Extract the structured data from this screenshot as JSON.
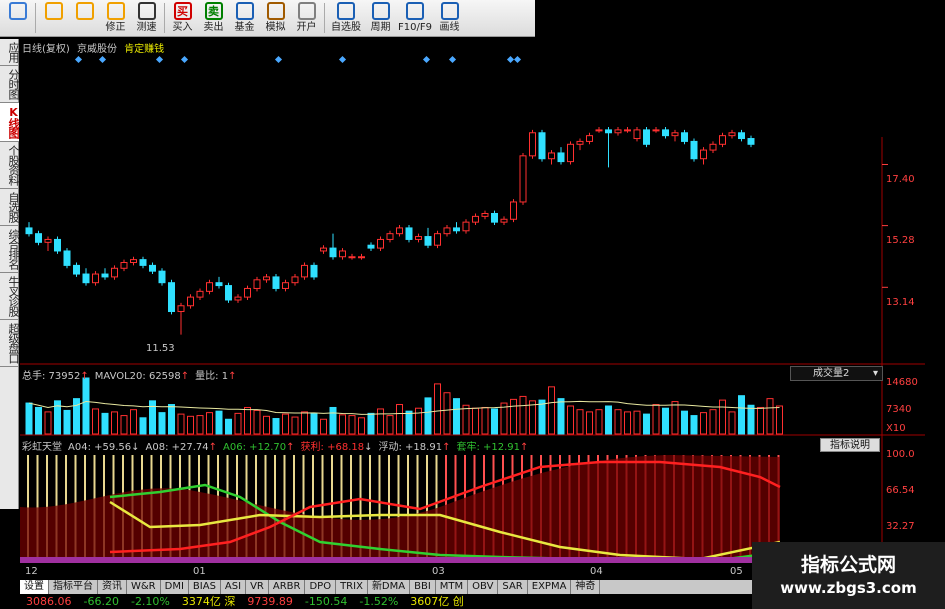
{
  "toolbar": [
    {
      "label": "",
      "icon": "app-icon",
      "color": "#3a7bd5"
    },
    {
      "label": "",
      "icon": "back-icon",
      "color": "#f0a000"
    },
    {
      "label": "",
      "icon": "up-down-icon",
      "color": "#f0a000"
    },
    {
      "label": "修正",
      "icon": "fix-icon",
      "color": "#f0a000"
    },
    {
      "label": "测速",
      "icon": "clock-icon",
      "color": "#333333"
    },
    {
      "label": "买入",
      "icon": "buy-icon",
      "glyph": "买",
      "color": "#d00000"
    },
    {
      "label": "卖出",
      "icon": "sell-icon",
      "glyph": "卖",
      "color": "#008000"
    },
    {
      "label": "基金",
      "icon": "fund-icon",
      "color": "#1a5fb4"
    },
    {
      "label": "模拟",
      "icon": "hammer-icon",
      "color": "#a05a00"
    },
    {
      "label": "开户",
      "icon": "lock-icon",
      "color": "#808080"
    },
    {
      "label": "自选股",
      "icon": "star-icon",
      "color": "#1a5fb4"
    },
    {
      "label": "周期",
      "icon": "period-icon",
      "color": "#1a5fb4"
    },
    {
      "label": "F10/F9",
      "icon": "f10-icon",
      "color": "#1a5fb4"
    },
    {
      "label": "画线",
      "icon": "pen-icon",
      "color": "#1a5fb4"
    }
  ],
  "left_tabs": [
    {
      "label": "应用",
      "active": false
    },
    {
      "label": "分时图",
      "active": false
    },
    {
      "label": "K线图",
      "active": true
    },
    {
      "label": "个股资料",
      "active": false
    },
    {
      "label": "自选股",
      "active": false
    },
    {
      "label": "综合排名",
      "active": false
    },
    {
      "label": "牛叉诊股",
      "active": false
    },
    {
      "label": "超级盘口",
      "active": false
    }
  ],
  "header": {
    "period": "日线(复权)",
    "stock": "京威股份",
    "formula": "肯定赚钱"
  },
  "volume": {
    "legend": [
      {
        "text": "总手: 73952",
        "arrow": "↑"
      },
      {
        "text": "MAVOL20: 62598",
        "arrow": "↑"
      },
      {
        "text": "量比: 1",
        "arrow": "↑"
      }
    ],
    "selector": "成交量2",
    "axis": [
      "14680",
      "7340",
      "X10"
    ]
  },
  "indicator": {
    "name": "彩虹天堂",
    "legend": [
      {
        "text": "A04: +59.56",
        "arrow": "↓",
        "color": "#c8c8c8"
      },
      {
        "text": "A08: +27.74",
        "arrow": "↑",
        "color": "#c8c8c8"
      },
      {
        "text": "A06: +12.70",
        "arrow": "↑",
        "color": "#30c030"
      },
      {
        "text": "获利: +68.18",
        "arrow": "↓",
        "color": "#ff3030"
      },
      {
        "text": "浮动: +18.91",
        "arrow": "↑",
        "color": "#c8c8c8"
      },
      {
        "text": "套牢: +12.91",
        "arrow": "↑",
        "color": "#30c030"
      }
    ],
    "help": "指标说明",
    "axis": [
      "100.0",
      "66.54",
      "32.27"
    ]
  },
  "price_axis": [
    "17.40",
    "15.28",
    "13.14"
  ],
  "low_label": "11.53",
  "date_labels": [
    "12",
    "01",
    "03",
    "04",
    "05"
  ],
  "bottom_tabs": [
    "设置",
    "指标平台",
    "资讯",
    "W&R",
    "DMI",
    "BIAS",
    "ASI",
    "VR",
    "ARBR",
    "DPO",
    "TRIX",
    "新DMA",
    "BBI",
    "MTM",
    "OBV",
    "SAR",
    "EXPMA",
    "神奇"
  ],
  "status": [
    {
      "text": "3086.06",
      "color": "#ff4040"
    },
    {
      "text": "-66.20",
      "color": "#30c030"
    },
    {
      "text": "-2.10%",
      "color": "#30c030"
    },
    {
      "text": "3374亿 深",
      "color": "#e8e800"
    },
    {
      "text": "9739.89",
      "color": "#ff4040"
    },
    {
      "text": "-150.54",
      "color": "#30c030"
    },
    {
      "text": "-1.52%",
      "color": "#30c030"
    },
    {
      "text": "3607亿 创",
      "color": "#e8e800"
    }
  ],
  "watermark": {
    "title": "指标公式网",
    "url": "www.zbgs3.com"
  },
  "chart_data": {
    "type": "candlestick",
    "price_ticks": [
      17.4,
      15.28,
      13.14
    ],
    "volume_ticks": [
      14680,
      7340
    ],
    "indicator_ticks": [
      100.0,
      66.54,
      32.27
    ],
    "low_marker": 11.53,
    "ylim": [
      11.0,
      18.7
    ],
    "candles": [
      [
        15.2,
        15.4,
        14.9,
        15.0
      ],
      [
        15.0,
        15.1,
        14.6,
        14.7
      ],
      [
        14.7,
        14.9,
        14.4,
        14.8
      ],
      [
        14.8,
        14.9,
        14.3,
        14.4
      ],
      [
        14.4,
        14.5,
        13.8,
        13.9
      ],
      [
        13.9,
        14.0,
        13.5,
        13.6
      ],
      [
        13.6,
        13.8,
        13.2,
        13.3
      ],
      [
        13.3,
        13.7,
        13.2,
        13.6
      ],
      [
        13.6,
        13.8,
        13.4,
        13.5
      ],
      [
        13.5,
        13.9,
        13.4,
        13.8
      ],
      [
        13.8,
        14.1,
        13.7,
        14.0
      ],
      [
        14.0,
        14.2,
        13.9,
        14.1
      ],
      [
        14.1,
        14.2,
        13.8,
        13.9
      ],
      [
        13.9,
        14.0,
        13.6,
        13.7
      ],
      [
        13.7,
        13.8,
        13.2,
        13.3
      ],
      [
        13.3,
        13.4,
        12.2,
        12.3
      ],
      [
        12.3,
        12.6,
        11.5,
        12.5
      ],
      [
        12.5,
        12.9,
        12.4,
        12.8
      ],
      [
        12.8,
        13.1,
        12.7,
        13.0
      ],
      [
        13.0,
        13.4,
        12.9,
        13.3
      ],
      [
        13.3,
        13.5,
        13.1,
        13.2
      ],
      [
        13.2,
        13.3,
        12.6,
        12.7
      ],
      [
        12.7,
        12.9,
        12.6,
        12.8
      ],
      [
        12.8,
        13.2,
        12.7,
        13.1
      ],
      [
        13.1,
        13.5,
        13.0,
        13.4
      ],
      [
        13.4,
        13.6,
        13.3,
        13.5
      ],
      [
        13.5,
        13.6,
        13.0,
        13.1
      ],
      [
        13.1,
        13.4,
        13.0,
        13.3
      ],
      [
        13.3,
        13.6,
        13.2,
        13.5
      ],
      [
        13.5,
        14.0,
        13.4,
        13.9
      ],
      [
        13.9,
        14.0,
        13.4,
        13.5
      ],
      [
        14.4,
        14.6,
        14.3,
        14.5
      ],
      [
        14.5,
        15.0,
        14.1,
        14.2
      ],
      [
        14.2,
        14.5,
        14.1,
        14.4
      ],
      [
        14.2,
        14.3,
        14.1,
        14.2
      ],
      [
        14.2,
        14.3,
        14.1,
        14.2
      ],
      [
        14.6,
        14.7,
        14.4,
        14.5
      ],
      [
        14.5,
        14.9,
        14.4,
        14.8
      ],
      [
        14.8,
        15.1,
        14.7,
        15.0
      ],
      [
        15.0,
        15.3,
        14.9,
        15.2
      ],
      [
        15.2,
        15.3,
        14.7,
        14.8
      ],
      [
        14.8,
        15.0,
        14.7,
        14.9
      ],
      [
        14.9,
        15.2,
        14.5,
        14.6
      ],
      [
        14.6,
        15.1,
        14.5,
        15.0
      ],
      [
        15.0,
        15.3,
        14.9,
        15.2
      ],
      [
        15.2,
        15.4,
        15.0,
        15.1
      ],
      [
        15.1,
        15.5,
        15.0,
        15.4
      ],
      [
        15.4,
        15.7,
        15.3,
        15.6
      ],
      [
        15.6,
        15.8,
        15.5,
        15.7
      ],
      [
        15.7,
        15.8,
        15.3,
        15.4
      ],
      [
        15.4,
        15.6,
        15.3,
        15.5
      ],
      [
        15.5,
        16.2,
        15.4,
        16.1
      ],
      [
        16.1,
        17.8,
        16.0,
        17.7
      ],
      [
        17.7,
        18.6,
        17.6,
        18.5
      ],
      [
        18.5,
        18.6,
        17.5,
        17.6
      ],
      [
        17.6,
        17.9,
        17.4,
        17.8
      ],
      [
        17.8,
        18.0,
        17.4,
        17.5
      ],
      [
        17.5,
        18.2,
        17.4,
        18.1
      ],
      [
        18.1,
        18.3,
        17.9,
        18.2
      ],
      [
        18.2,
        18.5,
        18.1,
        18.4
      ],
      [
        18.6,
        18.7,
        18.5,
        18.6
      ],
      [
        18.6,
        18.7,
        17.3,
        18.5
      ],
      [
        18.5,
        18.7,
        18.4,
        18.6
      ],
      [
        18.6,
        18.7,
        18.5,
        18.6
      ],
      [
        18.3,
        18.7,
        18.2,
        18.6
      ],
      [
        18.6,
        18.7,
        18.0,
        18.1
      ],
      [
        18.6,
        18.7,
        18.5,
        18.6
      ],
      [
        18.6,
        18.7,
        18.3,
        18.4
      ],
      [
        18.4,
        18.6,
        18.2,
        18.5
      ],
      [
        18.5,
        18.6,
        18.1,
        18.2
      ],
      [
        18.2,
        18.3,
        17.5,
        17.6
      ],
      [
        17.6,
        18.0,
        17.4,
        17.9
      ],
      [
        17.9,
        18.2,
        17.8,
        18.1
      ],
      [
        18.1,
        18.5,
        18.0,
        18.4
      ],
      [
        18.4,
        18.6,
        18.3,
        18.5
      ],
      [
        18.5,
        18.6,
        18.2,
        18.3
      ],
      [
        18.3,
        18.4,
        18.0,
        18.1
      ]
    ],
    "volumes": [
      4.2,
      3.6,
      3.0,
      4.5,
      3.2,
      4.8,
      7.6,
      3.4,
      2.8,
      3.0,
      2.5,
      3.3,
      2.2,
      4.5,
      2.9,
      4.0,
      2.7,
      2.4,
      2.5,
      2.9,
      3.1,
      2.0,
      2.8,
      3.6,
      3.2,
      2.4,
      2.1,
      2.7,
      2.3,
      3.0,
      2.8,
      2.0,
      3.6,
      2.6,
      2.5,
      2.2,
      2.8,
      3.4,
      2.5,
      4.0,
      3.1,
      3.5,
      4.9,
      6.8,
      5.6,
      4.8,
      3.9,
      3.5,
      3.6,
      3.4,
      4.2,
      4.7,
      5.1,
      4.5,
      4.6,
      6.4,
      4.8,
      3.8,
      3.3,
      3.0,
      3.3,
      3.8,
      3.3,
      3.0,
      3.1,
      2.7,
      4.0,
      3.5,
      4.4,
      3.1,
      2.5,
      2.9,
      3.3,
      4.6,
      3.0,
      5.2,
      3.9,
      3.6,
      4.8,
      3.8
    ]
  }
}
